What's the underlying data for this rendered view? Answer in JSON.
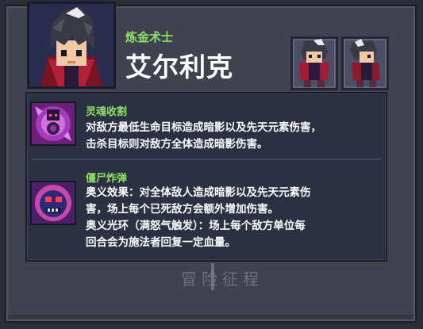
{
  "character": {
    "class": "炼金术士",
    "name": "艾尔利克"
  },
  "skins": [
    {
      "icon": "character-skin-front-icon"
    },
    {
      "icon": "character-skin-side-icon"
    }
  ],
  "skills": [
    {
      "name": "灵魂收割",
      "icon": "soul-reap-icon",
      "description_lines": [
        "对敌方最低生命目标造成暗影以及先天元素伤害，",
        "击杀目标则对敌方全体造成暗影伤害。"
      ]
    },
    {
      "name": "僵尸炸弹",
      "icon": "zombie-bomb-icon",
      "description_lines": [
        "奥义效果：对全体敌人造成暗影以及先天元素伤",
        "害，场上每个已死敌方会额外增加伤害。",
        "奥义光环（满怒气触发）：场上每个敌方单位每",
        "回合会为施法者回复一定血量。"
      ]
    }
  ],
  "watermark": "冒险征程",
  "colors": {
    "skill_name": "#8fe26a",
    "panel_bg": "#2c3043",
    "frame_bg": "#40424f"
  }
}
